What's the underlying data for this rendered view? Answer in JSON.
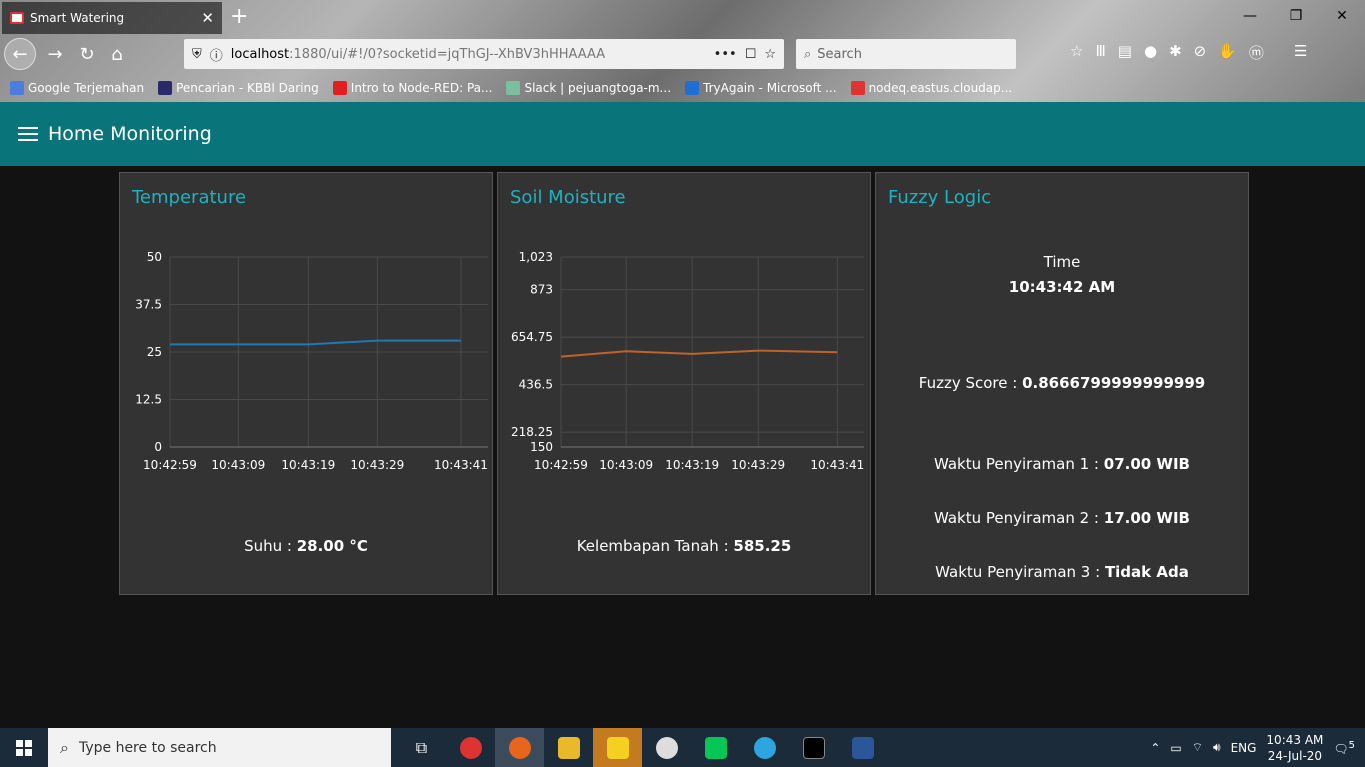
{
  "browser": {
    "tab_title": "Smart Watering",
    "url_host": "localhost",
    "url_path": ":1880/ui/#!/0?socketid=jqThGJ--XhBV3hHHAAAA",
    "search_placeholder": "Search",
    "bookmarks": [
      {
        "label": "Google Terjemahan",
        "color": "#4a7fe0"
      },
      {
        "label": "Pencarian - KBBI Daring",
        "color": "#2a2a6a"
      },
      {
        "label": "Intro to Node-RED: Pa...",
        "color": "#e02020"
      },
      {
        "label": "Slack | pejuangtoga-m...",
        "color": "#7ac0a0"
      },
      {
        "label": "TryAgain - Microsoft ...",
        "color": "#1e6fd0"
      },
      {
        "label": "nodeq.eastus.cloudap...",
        "color": "#d33"
      }
    ]
  },
  "app": {
    "title": "Home Monitoring"
  },
  "temperature": {
    "title": "Temperature",
    "readout_label": "Suhu : ",
    "readout_value": "28.00 °C",
    "chart_data": {
      "type": "line",
      "title": "Temperature",
      "x": [
        "10:42:59",
        "10:43:09",
        "10:43:19",
        "10:43:29",
        "10:43:41"
      ],
      "y_ticks": [
        "50",
        "37.5",
        "25",
        "12.5",
        "0"
      ],
      "ylim": [
        0,
        50
      ],
      "series": [
        {
          "values": [
            27,
            27,
            27,
            28,
            28
          ],
          "color": "#1f77b4"
        }
      ]
    }
  },
  "soil": {
    "title": "Soil Moisture",
    "readout_label": "Kelembapan Tanah : ",
    "readout_value": "585.25",
    "chart_data": {
      "type": "line",
      "title": "Soil Moisture",
      "x": [
        "10:42:59",
        "10:43:09",
        "10:43:19",
        "10:43:29",
        "10:43:41"
      ],
      "y_ticks": [
        "1,023",
        "873",
        "654.75",
        "436.5",
        "218.25",
        "150"
      ],
      "ylim": [
        150,
        1023
      ],
      "series": [
        {
          "values": [
            565,
            590,
            578,
            593,
            585.25
          ],
          "color": "#c0622a"
        }
      ]
    }
  },
  "fuzzy": {
    "title": "Fuzzy Logic",
    "time_label": "Time",
    "time_value": "10:43:42 AM",
    "score_label": "Fuzzy Score : ",
    "score_value": "0.8666799999999999",
    "w1_label": "Waktu Penyiraman 1 : ",
    "w1_value": "07.00 WIB",
    "w2_label": "Waktu Penyiraman 2 : ",
    "w2_value": "17.00 WIB",
    "w3_label": "Waktu Penyiraman 3 : ",
    "w3_value": "Tidak Ada"
  },
  "taskbar": {
    "search_placeholder": "Type here to search",
    "lang": "ENG",
    "time": "10:43 AM",
    "date": "24-Jul-20",
    "notifications": "5"
  }
}
